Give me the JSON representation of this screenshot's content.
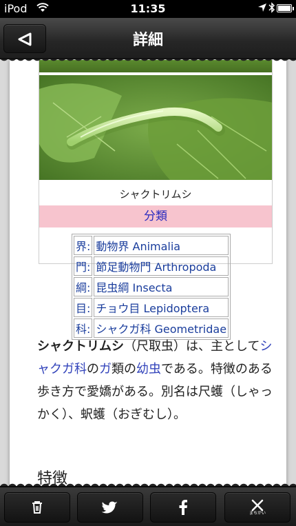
{
  "status_bar": {
    "carrier": "iPod",
    "time": "11:35"
  },
  "navbar": {
    "title": "詳細"
  },
  "article": {
    "image_caption": "シャクトリムシ",
    "classification_header": "分類",
    "taxonomy": [
      {
        "rank": "界",
        "colon": ":",
        "value": "動物界 Animalia"
      },
      {
        "rank": "門",
        "colon": ":",
        "value": "節足動物門 Arthropoda"
      },
      {
        "rank": "綱",
        "colon": ":",
        "value": "昆虫綱 Insecta"
      },
      {
        "rank": "目",
        "colon": ":",
        "value": "チョウ目 Lepidoptera"
      },
      {
        "rank": "科",
        "colon": ":",
        "value": "シャクガ科 Geometridae"
      }
    ],
    "intro": {
      "term": "シャクトリムシ",
      "p1": "（尺取虫）は、主として",
      "link1": "シャクガ科",
      "p2": "の",
      "link2": "ガ",
      "p3": "類の",
      "link3": "幼虫",
      "p4": "である。特徴のある歩き方で愛嬌がある。別名は尺蠖（しゃっかく）、蚇蠖（おぎむし）。"
    },
    "section_heading": "特徴"
  },
  "toolbar": {
    "buttons": [
      {
        "name": "delete",
        "icon": "trash-icon"
      },
      {
        "name": "twitter",
        "icon": "twitter-bird-icon"
      },
      {
        "name": "facebook",
        "icon": "facebook-f-icon",
        "glyph": "f"
      },
      {
        "name": "mistake",
        "icon": "cross-icon",
        "label": "まちがい"
      }
    ]
  },
  "colors": {
    "classification_bg": "#f7c4ce",
    "link": "#3344bb",
    "toolbar": "#1a1a1a"
  }
}
